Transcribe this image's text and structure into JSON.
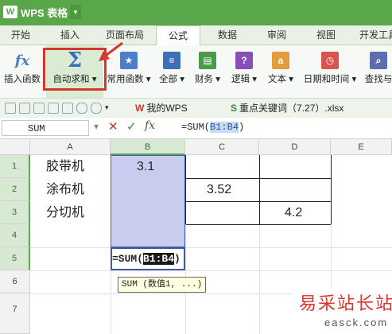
{
  "app": {
    "title": "WPS 表格",
    "logo": "W"
  },
  "tabs": [
    "开始",
    "插入",
    "页面布局",
    "公式",
    "数据",
    "审阅",
    "视图",
    "开发工具"
  ],
  "active_tab": "公式",
  "ribbon": {
    "insert_function": "插入函数",
    "autosum": "自动求和",
    "common_functions": "常用函数",
    "all": "全部",
    "finance": "财务",
    "logic": "逻辑",
    "text": "文本",
    "datetime": "日期和时间",
    "lookup": "查找与"
  },
  "doc_tabs": [
    "我的WPS",
    "重点关键词（7.27）.xlsx"
  ],
  "namebox": "SUM",
  "formula_bar": {
    "prefix": "=SUM(",
    "ref": "B1:B4",
    "suffix": ")"
  },
  "columns": [
    "A",
    "B",
    "C",
    "D",
    "E"
  ],
  "rows": [
    "1",
    "2",
    "3",
    "4",
    "5",
    "6",
    "7"
  ],
  "cells": {
    "A1": "胶带机",
    "A2": "涂布机",
    "A3": "分切机",
    "B1": "3.1",
    "C2": "3.52",
    "D3": "4.2"
  },
  "edit_cell": {
    "prefix": "=SUM(",
    "ref": "B1:B4",
    "suffix": ")"
  },
  "tooltip": "SUM (数值1, ...)",
  "watermark": {
    "cn": "易采站长站",
    "en": "easck.com"
  },
  "colors": {
    "accent": "#5aa64a",
    "highlight_red": "#d9352b",
    "selection": "#c9ccee"
  }
}
